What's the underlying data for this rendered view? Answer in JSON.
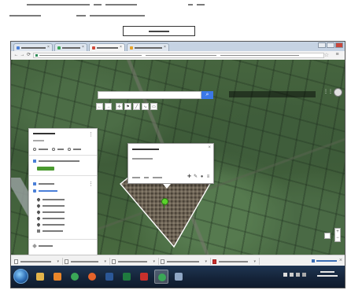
{
  "document": {
    "line1": "",
    "line2": "",
    "button": ""
  },
  "browser": {
    "tabs": [
      {
        "label": "",
        "active": false
      },
      {
        "label": "",
        "active": false
      },
      {
        "label": "",
        "active": true
      },
      {
        "label": "",
        "active": false
      }
    ],
    "url": ""
  },
  "map": {
    "search": {
      "placeholder": ""
    },
    "tools": [
      "←",
      "→",
      "✛",
      "⚑"
    ]
  },
  "sidebar": {
    "title": "",
    "subtitle": "",
    "actions": [
      "",
      "",
      ""
    ],
    "layer": "",
    "base_action": "",
    "group": "",
    "group_link": "",
    "items": [
      "",
      "",
      "",
      "",
      "",
      ""
    ],
    "footer": ""
  },
  "popup": {
    "title": "",
    "subtitle": "",
    "meta": "",
    "actions": [
      "✚",
      "✎",
      "●",
      "≡"
    ]
  },
  "downloads": {
    "items": [
      {
        "name": "",
        "type": "doc"
      },
      {
        "name": "",
        "type": "doc"
      },
      {
        "name": "",
        "type": "doc"
      },
      {
        "name": "",
        "type": "doc"
      },
      {
        "name": "",
        "type": "pdf"
      }
    ],
    "show_all": ""
  },
  "taskbar": {
    "apps": [
      {
        "name": "windows-explorer",
        "color": "#e3b44a"
      },
      {
        "name": "media-player",
        "color": "#e9862a"
      },
      {
        "name": "chrome",
        "color": "#3aa757"
      },
      {
        "name": "firefox",
        "color": "#e5632a"
      },
      {
        "name": "word",
        "color": "#2b5797"
      },
      {
        "name": "excel",
        "color": "#1f7a3f"
      },
      {
        "name": "adobe-reader",
        "color": "#c9302c"
      },
      {
        "name": "chrome-active",
        "color": "#3aa757"
      },
      {
        "name": "network",
        "color": "#8fa6c4"
      }
    ],
    "clock_time": "",
    "clock_date": ""
  },
  "colors": {
    "accent": "#3b78e7",
    "sidebar_button": "#4a9a2f",
    "pin": "#5bd32c"
  }
}
